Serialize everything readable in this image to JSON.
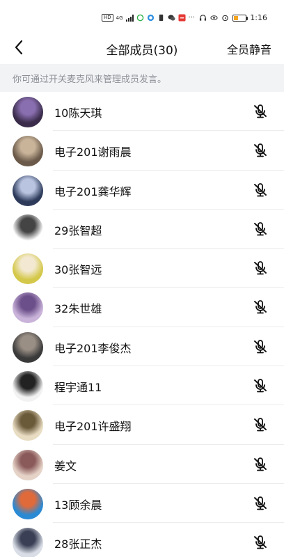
{
  "status_bar": {
    "hd_label": "HD",
    "net_label": "4G",
    "time": "1:16"
  },
  "header": {
    "title": "全部成员(30)",
    "mute_all": "全员静音"
  },
  "hint": "你可通过开关麦克风来管理成员发言。",
  "members": [
    {
      "name": "10陈天琪",
      "avatar_icon": "anime-avatar",
      "avatar_colors": [
        "#3a2c4a",
        "#8a6fb0"
      ]
    },
    {
      "name": "电子201谢雨晨",
      "avatar_icon": "photo-avatar",
      "avatar_colors": [
        "#6b5a4a",
        "#c9b49a"
      ]
    },
    {
      "name": "电子201龚华辉",
      "avatar_icon": "anime-avatar",
      "avatar_colors": [
        "#2d3a5a",
        "#b8c4e0"
      ]
    },
    {
      "name": "29张智超",
      "avatar_icon": "crown-avatar",
      "avatar_colors": [
        "#ffffff",
        "#444444"
      ]
    },
    {
      "name": "30张智远",
      "avatar_icon": "dog-avatar",
      "avatar_colors": [
        "#d4c84a",
        "#f3e9d2"
      ]
    },
    {
      "name": "32朱世雄",
      "avatar_icon": "anime-avatar",
      "avatar_colors": [
        "#c9b3d9",
        "#6b4f8a"
      ]
    },
    {
      "name": "电子201李俊杰",
      "avatar_icon": "photo-avatar",
      "avatar_colors": [
        "#3a3a3a",
        "#9a8f85"
      ]
    },
    {
      "name": "程宇通11",
      "avatar_icon": "manga-avatar",
      "avatar_colors": [
        "#f2f2f2",
        "#222222"
      ]
    },
    {
      "name": "电子201许盛翔",
      "avatar_icon": "cat-avatar",
      "avatar_colors": [
        "#e8dcc2",
        "#6b5a3a"
      ]
    },
    {
      "name": "姜文",
      "avatar_icon": "art-avatar",
      "avatar_colors": [
        "#e6d3c8",
        "#8a5a5a"
      ]
    },
    {
      "name": "13顾余晨",
      "avatar_icon": "cartoon-avatar",
      "avatar_colors": [
        "#2a8ad4",
        "#e06a3a"
      ]
    },
    {
      "name": "28张正杰",
      "avatar_icon": "anime-avatar",
      "avatar_colors": [
        "#d8dde6",
        "#3a3f55"
      ]
    }
  ],
  "icons": {
    "back": "back-arrow-icon",
    "mic_off": "mic-off-icon"
  }
}
